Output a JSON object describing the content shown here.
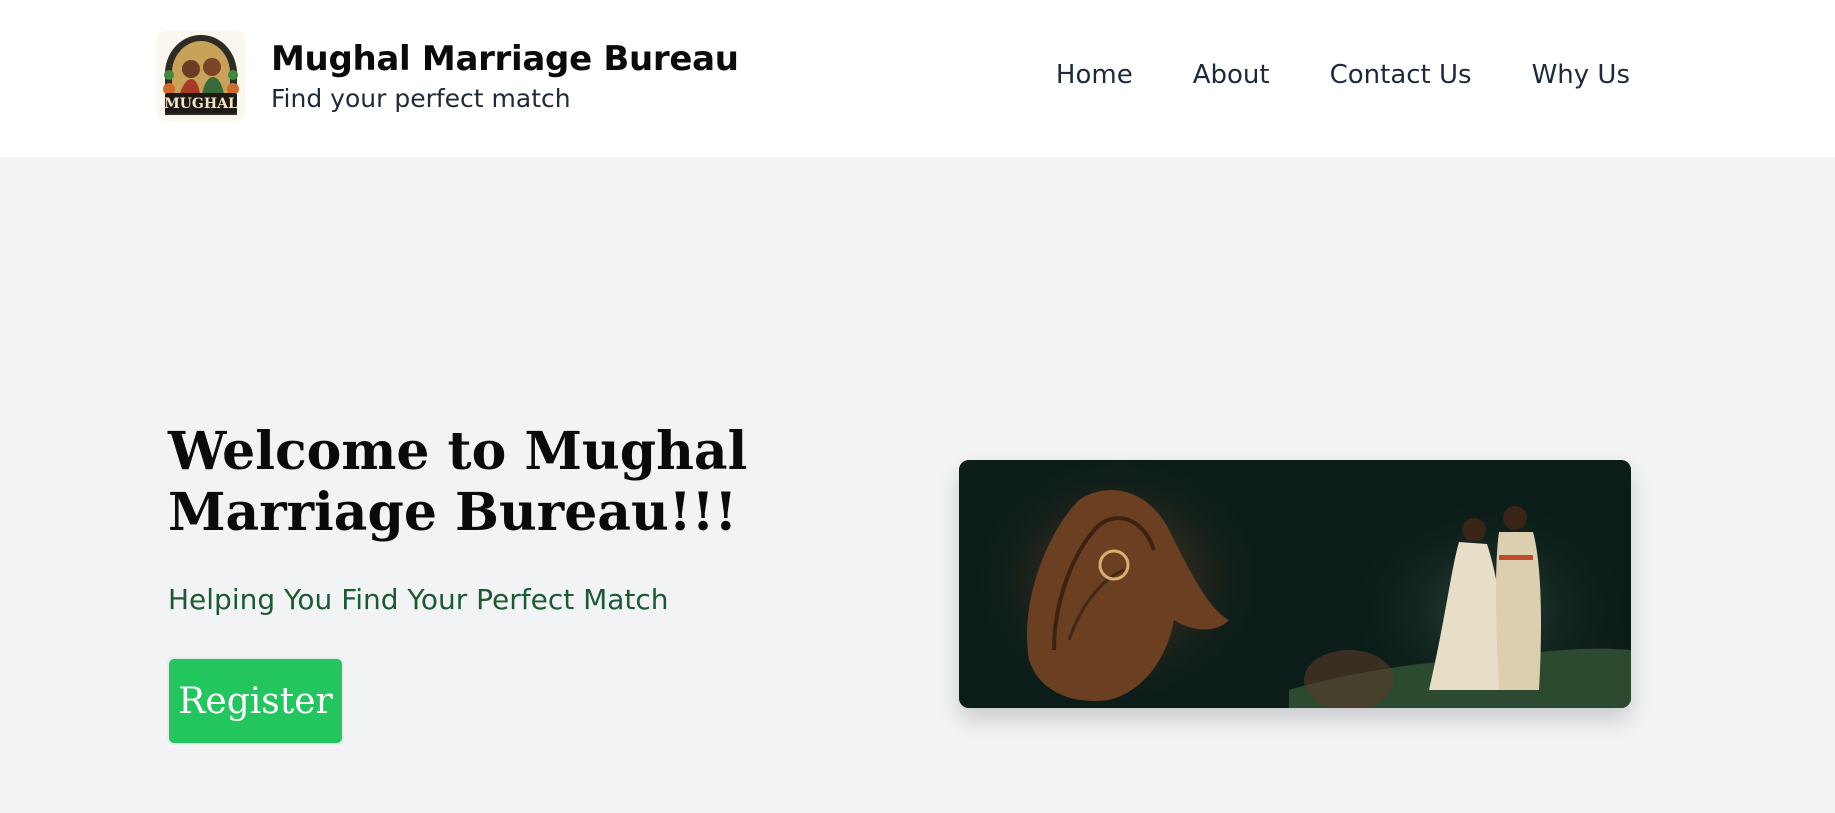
{
  "header": {
    "brand_title": "Mughal Marriage Bureau",
    "brand_tagline": "Find your perfect match",
    "logo_text": "MUGHAL",
    "nav": [
      "Home",
      "About",
      "Contact Us",
      "Why Us"
    ]
  },
  "hero": {
    "title": "Welcome to Mughal Marriage Bureau!!!",
    "subtitle": "Helping You Find Your Perfect Match",
    "register_label": "Register"
  },
  "colors": {
    "header_bg": "#ffffff",
    "page_bg": "#f2f3f5",
    "accent_green": "#22c55e",
    "subtitle_green": "#1c5a34"
  }
}
